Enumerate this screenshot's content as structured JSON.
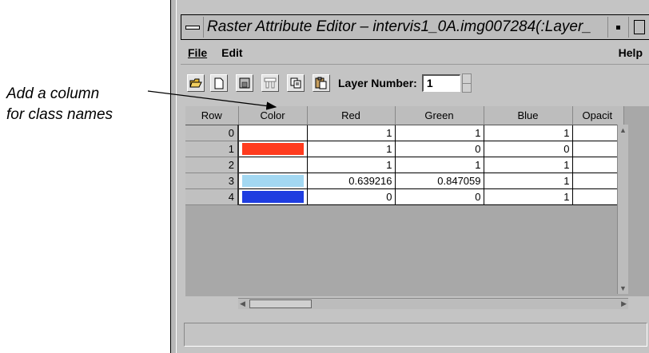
{
  "callout": {
    "line1": "Add a column",
    "line2": "for class names"
  },
  "window": {
    "title": "Raster Attribute Editor – intervis1_0A.img007284(:Layer_"
  },
  "menubar": {
    "file": "File",
    "edit": "Edit",
    "help": "Help"
  },
  "toolbar": {
    "layer_label": "Layer Number:",
    "layer_value": "1",
    "icons": [
      "open-folder-icon",
      "new-document-icon",
      "save-icon",
      "criteria-icon",
      "copy-icon",
      "paste-icon"
    ]
  },
  "table": {
    "columns": [
      "Row",
      "Color",
      "Red",
      "Green",
      "Blue",
      "Opacit"
    ],
    "rows": [
      {
        "row": "0",
        "color": "#ffffff",
        "red": "1",
        "green": "1",
        "blue": "1"
      },
      {
        "row": "1",
        "color": "#ff3b1e",
        "red": "1",
        "green": "0",
        "blue": "0"
      },
      {
        "row": "2",
        "color": "#ffffff",
        "red": "1",
        "green": "1",
        "blue": "1"
      },
      {
        "row": "3",
        "color": "#a3d8f2",
        "red": "0.639216",
        "green": "0.847059",
        "blue": "1"
      },
      {
        "row": "4",
        "color": "#1f3de0",
        "red": "0",
        "green": "0",
        "blue": "1"
      }
    ]
  }
}
